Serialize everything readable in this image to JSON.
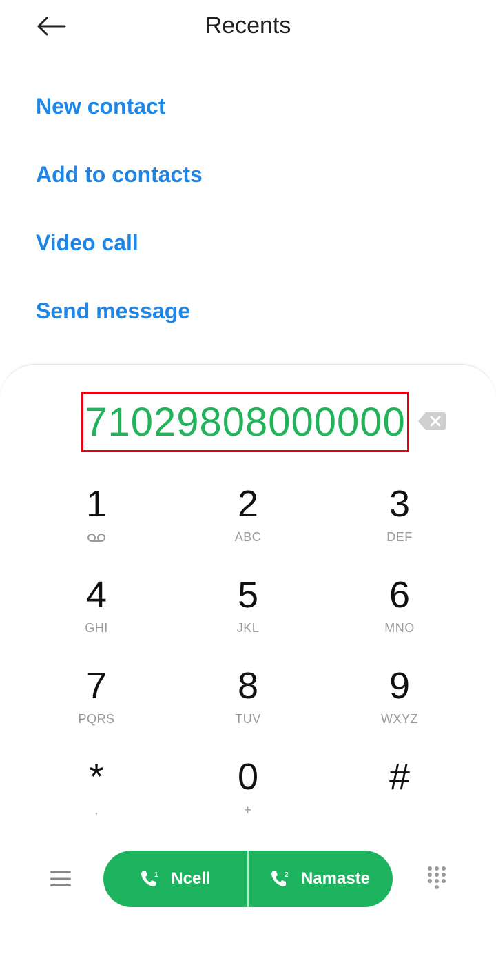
{
  "header": {
    "title": "Recents",
    "back_icon": "arrow-left-icon"
  },
  "actions": {
    "items": [
      {
        "label": "New contact"
      },
      {
        "label": "Add to contacts"
      },
      {
        "label": "Video call"
      },
      {
        "label": "Send message"
      }
    ]
  },
  "dialer": {
    "number": "71029808000000",
    "backspace_icon": "backspace-icon",
    "keys": [
      {
        "digit": "1",
        "letters": "",
        "extra_icon": "voicemail-icon"
      },
      {
        "digit": "2",
        "letters": "ABC"
      },
      {
        "digit": "3",
        "letters": "DEF"
      },
      {
        "digit": "4",
        "letters": "GHI"
      },
      {
        "digit": "5",
        "letters": "JKL"
      },
      {
        "digit": "6",
        "letters": "MNO"
      },
      {
        "digit": "7",
        "letters": "PQRS"
      },
      {
        "digit": "8",
        "letters": "TUV"
      },
      {
        "digit": "9",
        "letters": "WXYZ"
      },
      {
        "digit": "*",
        "letters": ","
      },
      {
        "digit": "0",
        "letters": "+"
      },
      {
        "digit": "#",
        "letters": ""
      }
    ]
  },
  "bottom_bar": {
    "menu_icon": "menu-icon",
    "sim1": {
      "label": "Ncell",
      "slot": "1",
      "icon": "phone-sim1-icon"
    },
    "sim2": {
      "label": "Namaste",
      "slot": "2",
      "icon": "phone-sim2-icon"
    },
    "dialpad_icon": "dialpad-icon"
  },
  "colors": {
    "accent_blue": "#1d86e6",
    "number_green": "#22b35a",
    "call_green": "#1db35f",
    "highlight_red": "#e60012"
  }
}
